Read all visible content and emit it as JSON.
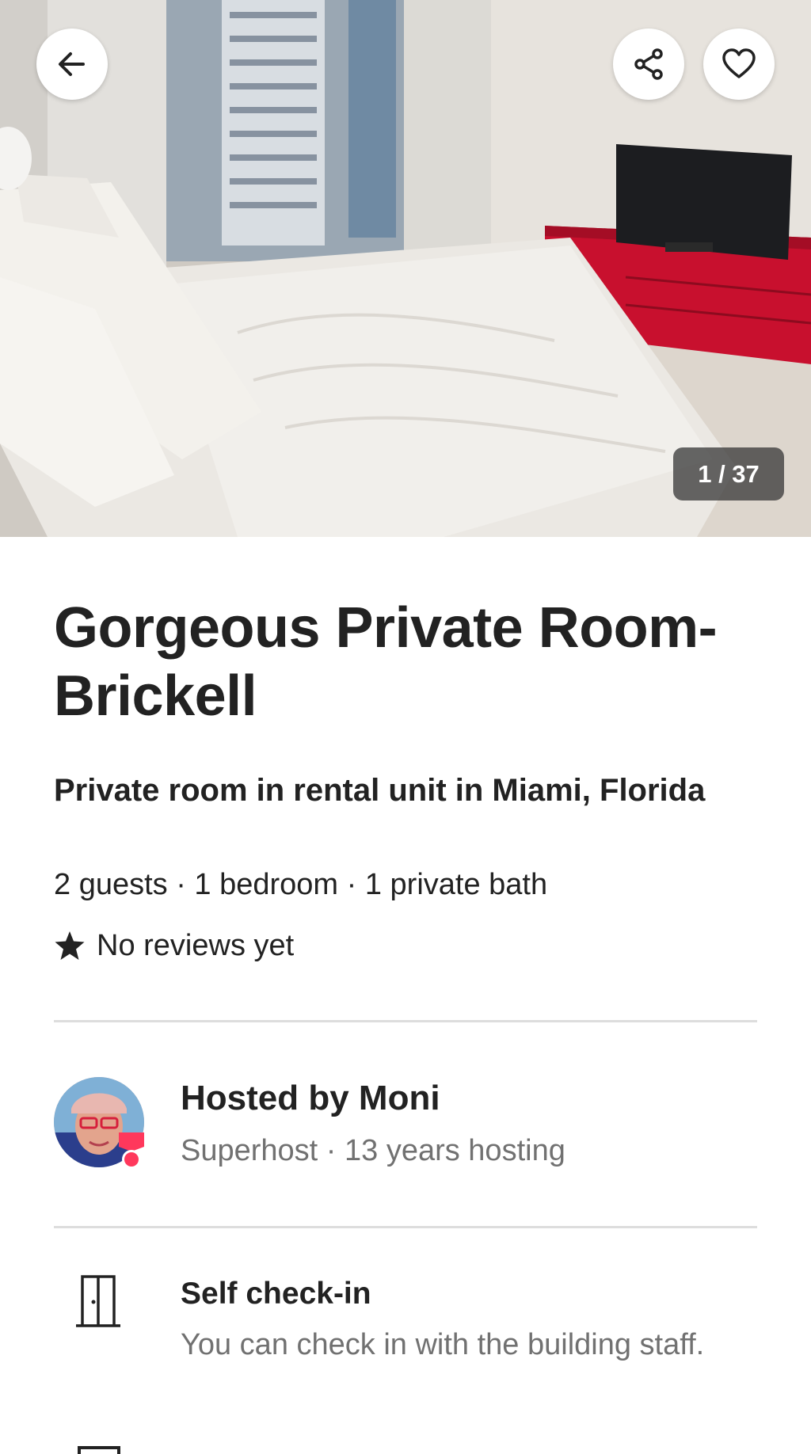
{
  "photo": {
    "counter": "1 / 37",
    "description_icon": "listing-photo"
  },
  "toolbar": {
    "back_icon": "arrow-left-icon",
    "share_icon": "share-icon",
    "save_icon": "heart-icon"
  },
  "listing": {
    "title": "Gorgeous Private Room-Brickell",
    "subtitle": "Private room in rental unit in Miami, Florida",
    "details": "2 guests · 1 bedroom · 1 private bath",
    "reviews": "No reviews yet"
  },
  "host": {
    "name": "Hosted by Moni",
    "meta": "Superhost · 13 years hosting"
  },
  "features": [
    {
      "icon": "door-icon",
      "title": "Self check-in",
      "description": "You can check in with the building staff."
    }
  ],
  "colors": {
    "brand": "#FF385C",
    "text": "#222222",
    "secondary_text": "#717171",
    "divider": "#DDDDDD",
    "dresser": "#C8102E"
  }
}
